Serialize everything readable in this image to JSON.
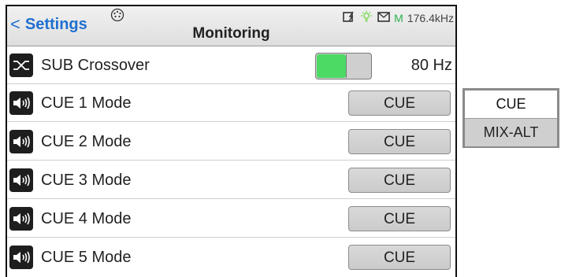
{
  "header": {
    "back_label": "Settings",
    "title": "Monitoring",
    "status": {
      "icons": [
        "battery-charging-icon",
        "light-bulb-icon",
        "mail-icon"
      ],
      "m_label": "M",
      "sample_rate": "176.4kHz",
      "bulb_color": "#7ed957",
      "m_color": "#2bb04a"
    }
  },
  "rows": [
    {
      "label": "SUB Crossover",
      "icon": "crossover-icon",
      "toggle_on": true,
      "value": "80 Hz"
    },
    {
      "label": "CUE 1 Mode",
      "icon": "speaker-icon",
      "value": "CUE"
    },
    {
      "label": "CUE 2 Mode",
      "icon": "speaker-icon",
      "value": "CUE"
    },
    {
      "label": "CUE 3 Mode",
      "icon": "speaker-icon",
      "value": "CUE"
    },
    {
      "label": "CUE 4 Mode",
      "icon": "speaker-icon",
      "value": "CUE"
    },
    {
      "label": "CUE 5 Mode",
      "icon": "speaker-icon",
      "value": "CUE"
    }
  ],
  "dropdown": {
    "options": [
      "CUE",
      "MIX-ALT"
    ]
  },
  "colors": {
    "accent_blue": "#1f6fd0",
    "toggle_green": "#4cd964"
  }
}
